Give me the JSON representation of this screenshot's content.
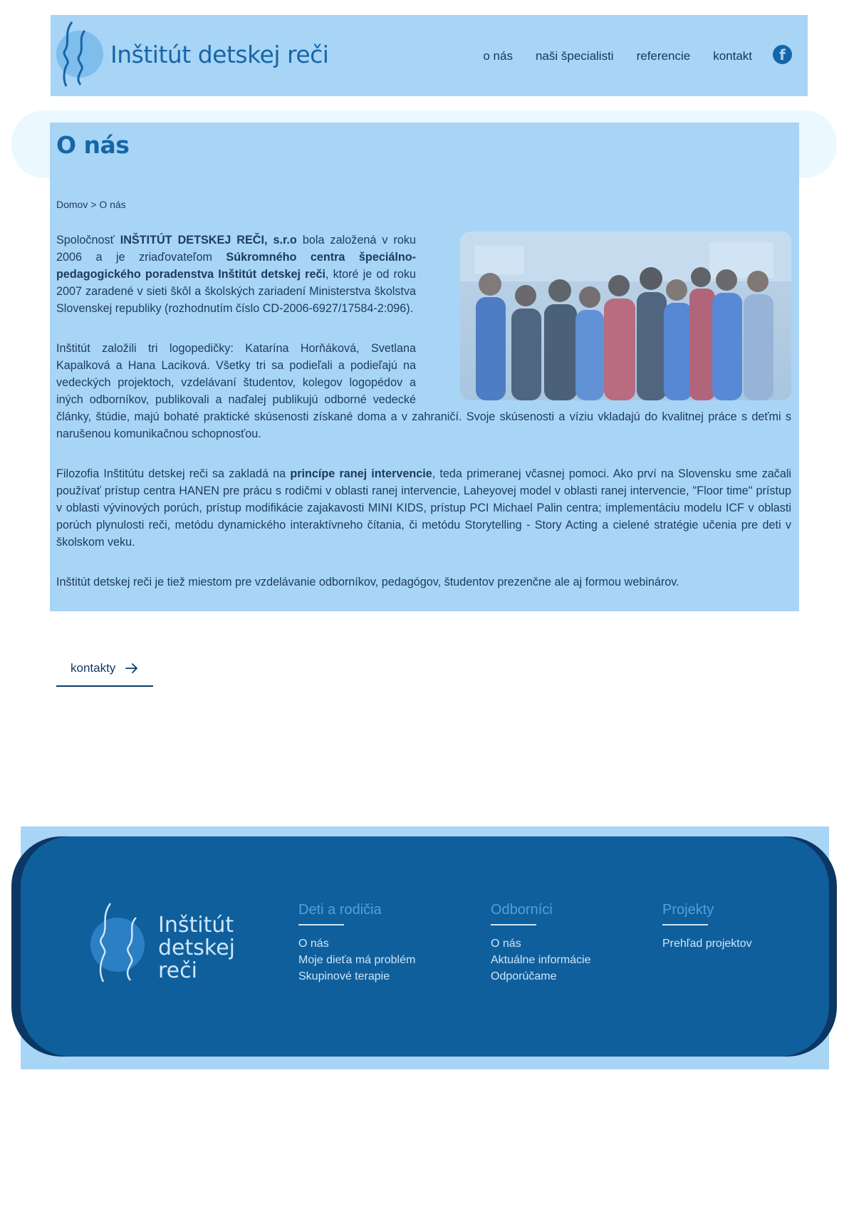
{
  "header": {
    "title": "Inštitút detskej reči",
    "nav": [
      "o nás",
      "naši špecialisti",
      "referencie",
      "kontakt"
    ],
    "facebook_icon": "facebook-icon"
  },
  "page": {
    "title": "O nás",
    "breadcrumb": {
      "home": "Domov",
      "separator": ">",
      "current": "O nás"
    }
  },
  "content": {
    "p1": {
      "a": "Spoločnosť ",
      "b": "INŠTITÚT DETSKEJ REČI, s.r.o",
      "c": " bola založená v roku 2006 a je zriaďovateľom ",
      "d": "Súkromného centra špeciálno-pedagogického poradenstva Inštitút detskej reči",
      "e": ", ktoré je od roku 2007 zaradené v sieti škôl a školských zariadení Ministerstva školstva Slovenskej republiky (rozhodnutím číslo CD-2006-6927/17584-2:096)."
    },
    "p2": "Inštitút založili tri logopedičky: Katarína Horňáková, Svetlana Kapalková a Hana Laciková. Všetky tri sa podieľali a podieľajú na vedeckých projektoch, vzdelávaní študentov, kolegov logopédov a iných odborníkov, publikovali a naďalej publikujú odborné vedecké články, štúdie, majú bohaté praktické skúsenosti získané doma a v zahraničí. Svoje skúsenosti a víziu vkladajú do kvalitnej práce s deťmi s narušenou komunikačnou schopnosťou.",
    "p3": {
      "a": "Filozofia Inštitútu detskej reči sa zakladá na ",
      "b": "princípe ranej intervencie",
      "c": ", teda primeranej včasnej pomoci. Ako prví na Slovensku sme začali používať prístup centra HANEN pre prácu s rodičmi v oblasti ranej intervencie, Laheyovej model v oblasti ranej intervencie, \"Floor time\" prístup v oblasti vývinových porúch, prístup modifikácie zajakavosti MINI KIDS, prístup PCI Michael Palin centra; implementáciu modelu ICF v oblasti porúch plynulosti reči, metódu dynamického interaktívneho čítania, či metódu Storytelling - Story Acting a cielené stratégie učenia pre deti v školskom veku."
    },
    "p4": "Inštitút detskej reči je tiež miestom pre vzdelávanie odborníkov, pedagógov, študentov prezenčne ale aj formou webinárov."
  },
  "contact_button": {
    "label": "kontakty",
    "icon": "arrow-right-icon"
  },
  "footer": {
    "brand": [
      "Inštitút",
      "detskej",
      "reči"
    ],
    "columns": [
      {
        "title": "Deti a rodičia",
        "items": [
          "O nás",
          "Moje dieťa má problém",
          "Skupinové terapie"
        ]
      },
      {
        "title": "Odborníci",
        "items": [
          "O nás",
          "Aktuálne informácie",
          "Odporúčame"
        ]
      },
      {
        "title": "Projekty",
        "items": [
          "Prehľad projektov"
        ]
      }
    ]
  },
  "colors": {
    "accent": "#1566a8",
    "header_bg": "#a8d5f5",
    "footer_bg": "#0f5f9d",
    "text": "#1d3a5c"
  }
}
